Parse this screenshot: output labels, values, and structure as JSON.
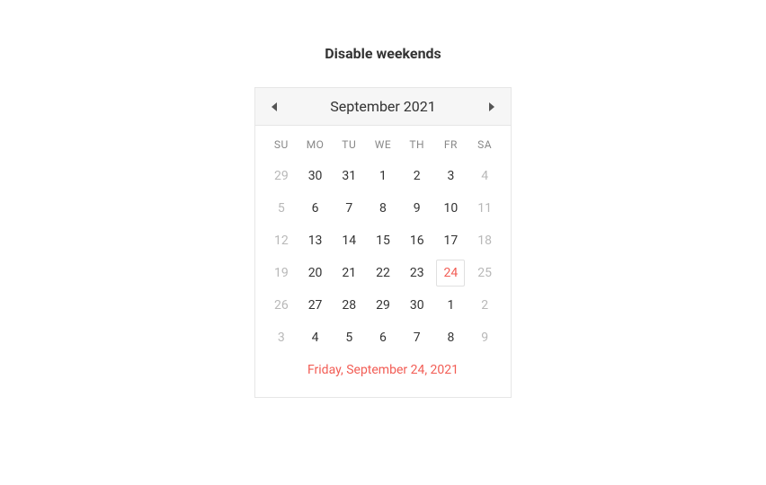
{
  "title": "Disable weekends",
  "calendar": {
    "month_label": "September 2021",
    "weekdays": [
      "SU",
      "MO",
      "TU",
      "WE",
      "TH",
      "FR",
      "SA"
    ],
    "days": [
      {
        "n": "29",
        "disabled": true,
        "other": true,
        "selected": false
      },
      {
        "n": "30",
        "disabled": false,
        "other": true,
        "selected": false
      },
      {
        "n": "31",
        "disabled": false,
        "other": true,
        "selected": false
      },
      {
        "n": "1",
        "disabled": false,
        "other": false,
        "selected": false
      },
      {
        "n": "2",
        "disabled": false,
        "other": false,
        "selected": false
      },
      {
        "n": "3",
        "disabled": false,
        "other": false,
        "selected": false
      },
      {
        "n": "4",
        "disabled": true,
        "other": false,
        "selected": false
      },
      {
        "n": "5",
        "disabled": true,
        "other": false,
        "selected": false
      },
      {
        "n": "6",
        "disabled": false,
        "other": false,
        "selected": false
      },
      {
        "n": "7",
        "disabled": false,
        "other": false,
        "selected": false
      },
      {
        "n": "8",
        "disabled": false,
        "other": false,
        "selected": false
      },
      {
        "n": "9",
        "disabled": false,
        "other": false,
        "selected": false
      },
      {
        "n": "10",
        "disabled": false,
        "other": false,
        "selected": false
      },
      {
        "n": "11",
        "disabled": true,
        "other": false,
        "selected": false
      },
      {
        "n": "12",
        "disabled": true,
        "other": false,
        "selected": false
      },
      {
        "n": "13",
        "disabled": false,
        "other": false,
        "selected": false
      },
      {
        "n": "14",
        "disabled": false,
        "other": false,
        "selected": false
      },
      {
        "n": "15",
        "disabled": false,
        "other": false,
        "selected": false
      },
      {
        "n": "16",
        "disabled": false,
        "other": false,
        "selected": false
      },
      {
        "n": "17",
        "disabled": false,
        "other": false,
        "selected": false
      },
      {
        "n": "18",
        "disabled": true,
        "other": false,
        "selected": false
      },
      {
        "n": "19",
        "disabled": true,
        "other": false,
        "selected": false
      },
      {
        "n": "20",
        "disabled": false,
        "other": false,
        "selected": false
      },
      {
        "n": "21",
        "disabled": false,
        "other": false,
        "selected": false
      },
      {
        "n": "22",
        "disabled": false,
        "other": false,
        "selected": false
      },
      {
        "n": "23",
        "disabled": false,
        "other": false,
        "selected": false
      },
      {
        "n": "24",
        "disabled": false,
        "other": false,
        "selected": true
      },
      {
        "n": "25",
        "disabled": true,
        "other": false,
        "selected": false
      },
      {
        "n": "26",
        "disabled": true,
        "other": false,
        "selected": false
      },
      {
        "n": "27",
        "disabled": false,
        "other": false,
        "selected": false
      },
      {
        "n": "28",
        "disabled": false,
        "other": false,
        "selected": false
      },
      {
        "n": "29",
        "disabled": false,
        "other": false,
        "selected": false
      },
      {
        "n": "30",
        "disabled": false,
        "other": false,
        "selected": false
      },
      {
        "n": "1",
        "disabled": false,
        "other": true,
        "selected": false
      },
      {
        "n": "2",
        "disabled": true,
        "other": true,
        "selected": false
      },
      {
        "n": "3",
        "disabled": true,
        "other": true,
        "selected": false
      },
      {
        "n": "4",
        "disabled": false,
        "other": true,
        "selected": false
      },
      {
        "n": "5",
        "disabled": false,
        "other": true,
        "selected": false
      },
      {
        "n": "6",
        "disabled": false,
        "other": true,
        "selected": false
      },
      {
        "n": "7",
        "disabled": false,
        "other": true,
        "selected": false
      },
      {
        "n": "8",
        "disabled": false,
        "other": true,
        "selected": false
      },
      {
        "n": "9",
        "disabled": true,
        "other": true,
        "selected": false
      }
    ],
    "selected_date_label": "Friday, September 24, 2021"
  }
}
